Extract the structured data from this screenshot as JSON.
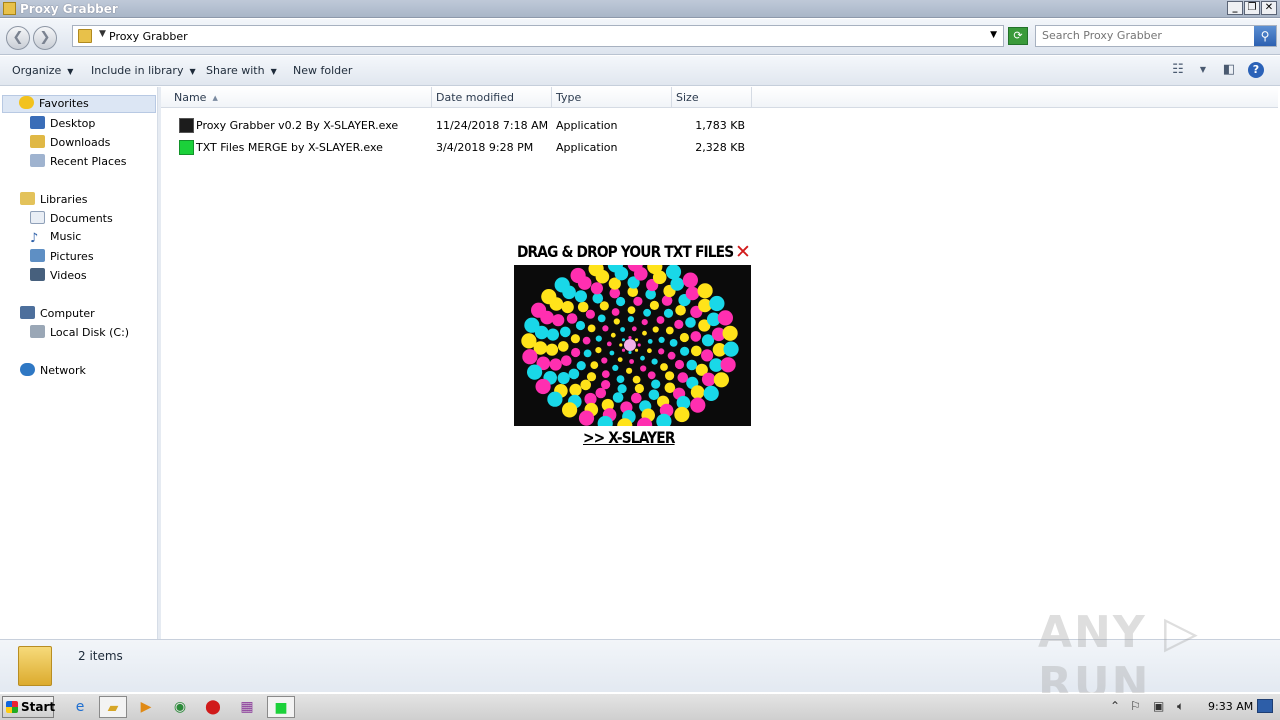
{
  "window": {
    "title": "Proxy Grabber"
  },
  "address": {
    "path": "Proxy Grabber",
    "search_placeholder": "Search Proxy Grabber"
  },
  "toolbar": {
    "organize": "Organize",
    "include_in_library": "Include in library",
    "share_with": "Share with",
    "new_folder": "New folder"
  },
  "nav": {
    "favorites": "Favorites",
    "desktop": "Desktop",
    "downloads": "Downloads",
    "recent_places": "Recent Places",
    "libraries": "Libraries",
    "documents": "Documents",
    "music": "Music",
    "pictures": "Pictures",
    "videos": "Videos",
    "computer": "Computer",
    "local_disk": "Local Disk (C:)",
    "network": "Network"
  },
  "columns": {
    "name": "Name",
    "date_modified": "Date modified",
    "type": "Type",
    "size": "Size"
  },
  "files": [
    {
      "name": "Proxy Grabber v0.2 By X-SLAYER.exe",
      "date": "11/24/2018 7:18 AM",
      "type": "Application",
      "size": "1,783 KB",
      "icon": "dark-app-icon"
    },
    {
      "name": "TXT Files MERGE by X-SLAYER.exe",
      "date": "3/4/2018 9:28 PM",
      "type": "Application",
      "size": "2,328 KB",
      "icon": "green-gamepad-icon"
    }
  ],
  "popup": {
    "title": "DRAG & DROP YOUR TXT FILES",
    "close": "✕",
    "link": ">> X-SLAYER"
  },
  "details": {
    "count": "2 items"
  },
  "watermark": "ANY RUN",
  "taskbar": {
    "start": "Start",
    "clock": "9:33 AM"
  },
  "colors": {
    "accent": "#2b62b8",
    "close_red": "#d21a1a"
  }
}
